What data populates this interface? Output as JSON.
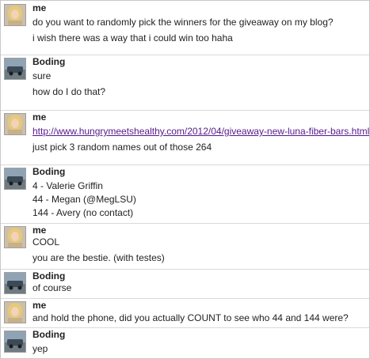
{
  "messages": [
    {
      "sender": "me",
      "avatar": "woman-portrait-avatar",
      "lines": [
        "do you want to randomly pick the winners for the giveaway on my blog?",
        "i wish there was a way that i could win too haha"
      ]
    },
    {
      "sender": "Boding",
      "avatar": "car-photo-avatar",
      "lines": [
        "sure",
        "how do I do that?"
      ]
    },
    {
      "sender": "me",
      "avatar": "woman-portrait-avatar",
      "link": "http://www.hungrymeetshealthy.com/2012/04/giveaway-new-luna-fiber-bars.html",
      "lines": [
        "just pick 3 random names out of those 264"
      ]
    },
    {
      "sender": "Boding",
      "avatar": "car-photo-avatar",
      "lines": [
        "4 - Valerie Griffin",
        "44 - Megan (@MegLSU)",
        "144 - Avery (no contact)"
      ]
    },
    {
      "sender": "me",
      "avatar": "woman-portrait-avatar",
      "lines": [
        "COOL",
        "you are the bestie. (with testes)"
      ]
    },
    {
      "sender": "Boding",
      "avatar": "car-photo-avatar",
      "lines": [
        "of course"
      ]
    },
    {
      "sender": "me",
      "avatar": "woman-portrait-avatar",
      "lines": [
        "and hold the phone, did you actually COUNT to see who 44 and 144 were?"
      ]
    },
    {
      "sender": "Boding",
      "avatar": "car-photo-avatar",
      "lines": [
        "yep"
      ]
    }
  ],
  "colors": {
    "link": "#551a8b",
    "divider": "#d9d9d9",
    "text": "#222222"
  }
}
